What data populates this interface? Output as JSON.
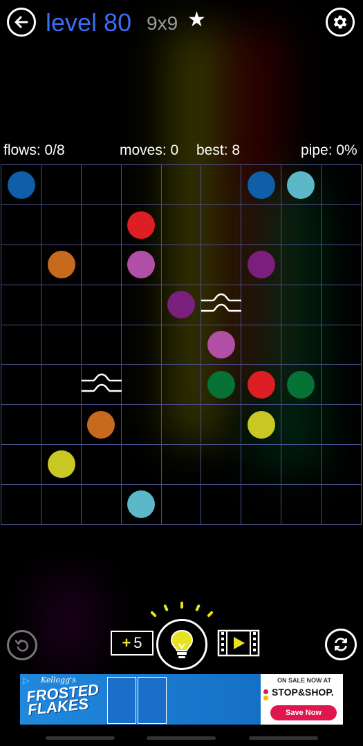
{
  "header": {
    "level_title": "level 80",
    "grid_size": "9x9",
    "star": "★"
  },
  "stats": {
    "flows": "flows: 0/8",
    "moves": "moves: 0",
    "best": "best: 8",
    "pipe": "pipe: 0%"
  },
  "board": {
    "rows": 9,
    "cols": 9,
    "dots": [
      {
        "row": 0,
        "col": 0,
        "color": "dark-blue"
      },
      {
        "row": 0,
        "col": 6,
        "color": "dark-blue"
      },
      {
        "row": 0,
        "col": 7,
        "color": "cyan"
      },
      {
        "row": 1,
        "col": 3,
        "color": "red"
      },
      {
        "row": 2,
        "col": 1,
        "color": "orange"
      },
      {
        "row": 2,
        "col": 3,
        "color": "pink"
      },
      {
        "row": 2,
        "col": 6,
        "color": "purple"
      },
      {
        "row": 3,
        "col": 4,
        "color": "purple"
      },
      {
        "row": 4,
        "col": 5,
        "color": "pink"
      },
      {
        "row": 5,
        "col": 5,
        "color": "green"
      },
      {
        "row": 5,
        "col": 6,
        "color": "red"
      },
      {
        "row": 5,
        "col": 7,
        "color": "green"
      },
      {
        "row": 6,
        "col": 2,
        "color": "orange"
      },
      {
        "row": 6,
        "col": 6,
        "color": "yellow"
      },
      {
        "row": 7,
        "col": 1,
        "color": "yellow"
      },
      {
        "row": 8,
        "col": 3,
        "color": "cyan"
      }
    ],
    "bridges": [
      {
        "row": 3,
        "col": 5
      },
      {
        "row": 5,
        "col": 2
      }
    ]
  },
  "colors": {
    "dark-blue": "#0e5ea8",
    "cyan": "#5cb8c8",
    "red": "#dd1e22",
    "orange": "#c86a1e",
    "pink": "#b14fa6",
    "purple": "#7a1f7e",
    "green": "#077236",
    "yellow": "#c9c722",
    "title_blue": "#3d6cf5",
    "grid_line": "#4b4f8c"
  },
  "controls": {
    "hint_count_prefix": "+",
    "hint_count_value": "5"
  },
  "ad": {
    "brand": "Kellogg's",
    "product": "FROSTED FLAKES",
    "on_sale": "ON SALE NOW AT",
    "store": "STOP&SHOP.",
    "cta": "Save Now"
  }
}
